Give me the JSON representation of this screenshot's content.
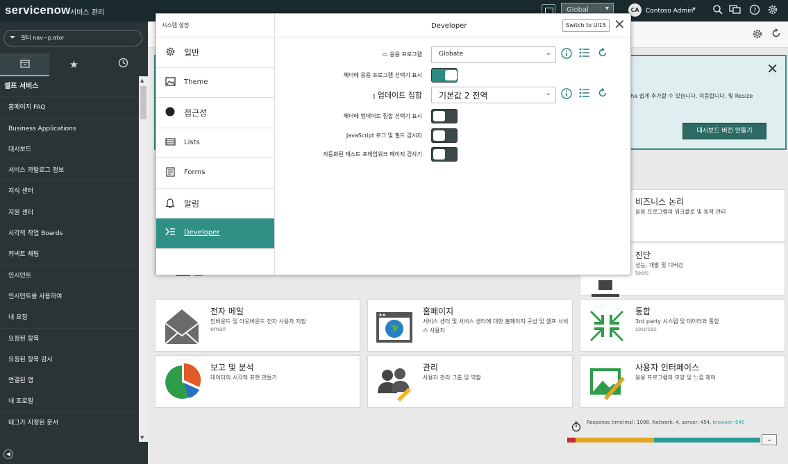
{
  "header": {
    "logo": "servicenow",
    "app_title": "서비스 관리",
    "scope_value": "Global",
    "avatar_initials": "CA",
    "user_name": "Contoso Admin"
  },
  "leftnav": {
    "filter_placeholder": "필터 nav~p.ator",
    "items": [
      {
        "label": "셀프 서비스",
        "head": true
      },
      {
        "label": "홈페이지 FAQ"
      },
      {
        "label": "Business Applications"
      },
      {
        "label": "대시보드"
      },
      {
        "label": "서비스 카탈로그 정보"
      },
      {
        "label": "지식 센터"
      },
      {
        "label": "지원 센터"
      },
      {
        "label": "시각적 작업 Boards"
      },
      {
        "label": "커넥트 채팅"
      },
      {
        "label": "인시던트"
      },
      {
        "label": "인시던트를 사용하여"
      },
      {
        "label": "내 요청"
      },
      {
        "label": "요청된 항목"
      },
      {
        "label": "요청된 항목 감시"
      },
      {
        "label": "연결된 앱"
      },
      {
        "label": "내 프로필"
      },
      {
        "label": "태그가 지정된 문서"
      }
    ]
  },
  "banner": {
    "text": "tha 쉽게 추가할 수 있습니다. 이동합니다. 및 Resize",
    "button_label": "대시보드 버전 만들기"
  },
  "cards": [
    {
      "title": "비즈니스 논리",
      "desc": "응용 프로그램의 워크플로 및 동작 관리",
      "sub": ""
    },
    {
      "title": "진단",
      "desc": "성능, 개발 및 디버깅",
      "sub": "tools"
    },
    {
      "title": "전자 메일",
      "desc": "인바운드 및 아웃바운드 전자 사용자 지정",
      "sub": "email"
    },
    {
      "title": "홈페이지",
      "desc": "서비스 센터 및 서비스 센터에 대한 홈페이지 구성 및 셀프 서비스 사용자",
      "sub": ""
    },
    {
      "title": "통합",
      "desc": "3rd party 시스템 및 데이터와 통합",
      "sub": "sources"
    },
    {
      "title": "보고 및 분석",
      "desc": "데이터의 시각적 표현 만들기",
      "sub": ""
    },
    {
      "title": "관리",
      "desc": "사용자 관리 그룹 및 역할",
      "sub": ""
    },
    {
      "title": "사용자 인터페이스",
      "desc": "응용 프로그램의 모양 및 느낌 제어",
      "sub": ""
    }
  ],
  "perf": {
    "text": "Response time(ms): 1098, Network: 4, server: 454, ",
    "browser": "browser: 640"
  },
  "modal": {
    "left_title": "시스템 설정",
    "categories": [
      {
        "label": "일반",
        "icon": "gear-icon"
      },
      {
        "label": "Theme",
        "icon": "image-icon"
      },
      {
        "label": "접근성",
        "icon": "circle-icon"
      },
      {
        "label": "Lists",
        "icon": "list-icon"
      },
      {
        "label": "Forms",
        "icon": "form-icon"
      },
      {
        "label": "알림",
        "icon": "bell-icon"
      },
      {
        "label": "Developer",
        "icon": "developer-icon"
      }
    ],
    "header_title": "Developer",
    "switch_label": "Switch to UI15",
    "rows": {
      "app_label": "응용 프로그램",
      "app_value": "Globate",
      "show_app_label": "헤더에 응용 프로그램 선택기 표시",
      "show_app_on": true,
      "update_label": "업데이트 집합",
      "update_value": "기본값 2 전역",
      "show_update_label": "헤더에 업데이트 집합 선택기 표시",
      "show_update_on": false,
      "js_label": "JavaScript 로그 및 필드 감시자",
      "js_on": false,
      "auto_label": "자동화된 테스트 프레임워크 페이지 검사기",
      "auto_on": false
    }
  },
  "colors": {
    "accent": "#2f9186",
    "header_bg": "#1b2a2c",
    "nav_bg": "#2a3436",
    "perf_bar": [
      "#c92b2b",
      "#e0a521",
      "#2a9a95"
    ]
  }
}
